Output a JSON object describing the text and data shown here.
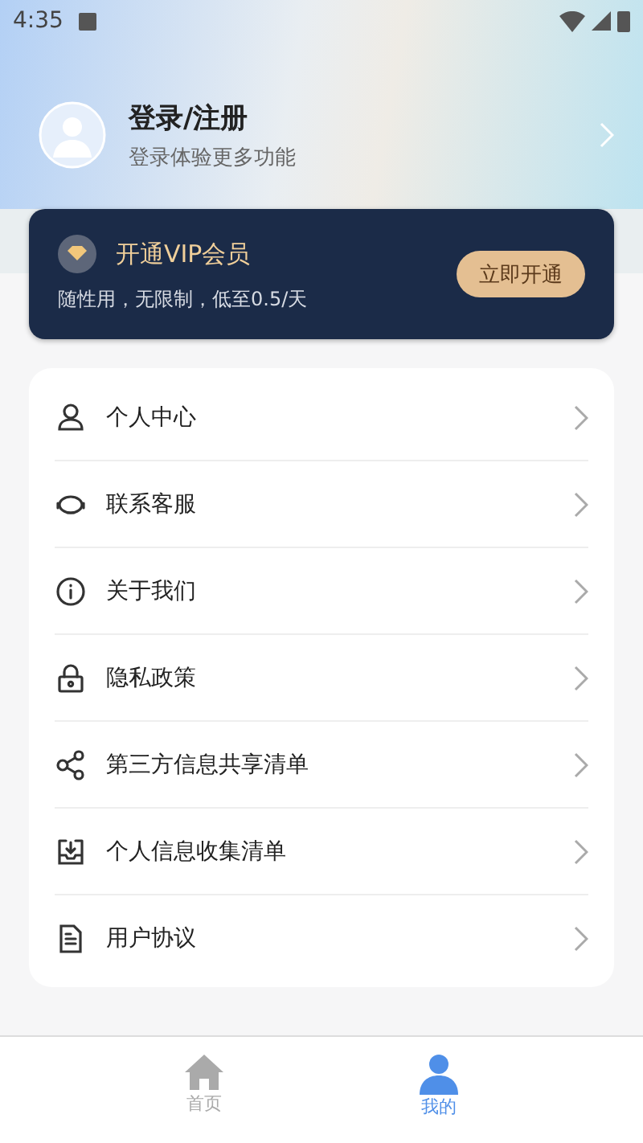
{
  "status_bar": {
    "time": "4:35"
  },
  "profile": {
    "title": "登录/注册",
    "subtitle": "登录体验更多功能"
  },
  "vip": {
    "title": "开通VIP会员",
    "subtitle": "随性用，无限制，低至0.5/天",
    "button": "立即开通"
  },
  "menu": [
    {
      "kind": "person",
      "label": "个人中心"
    },
    {
      "kind": "headset",
      "label": "联系客服"
    },
    {
      "kind": "info",
      "label": "关于我们"
    },
    {
      "kind": "lock",
      "label": "隐私政策"
    },
    {
      "kind": "share",
      "label": "第三方信息共享清单"
    },
    {
      "kind": "inbox",
      "label": "个人信息收集清单"
    },
    {
      "kind": "document",
      "label": "用户协议"
    }
  ],
  "tabs": [
    {
      "kind": "home",
      "label": "首页",
      "selected": false
    },
    {
      "kind": "user",
      "label": "我的",
      "selected": true
    }
  ]
}
